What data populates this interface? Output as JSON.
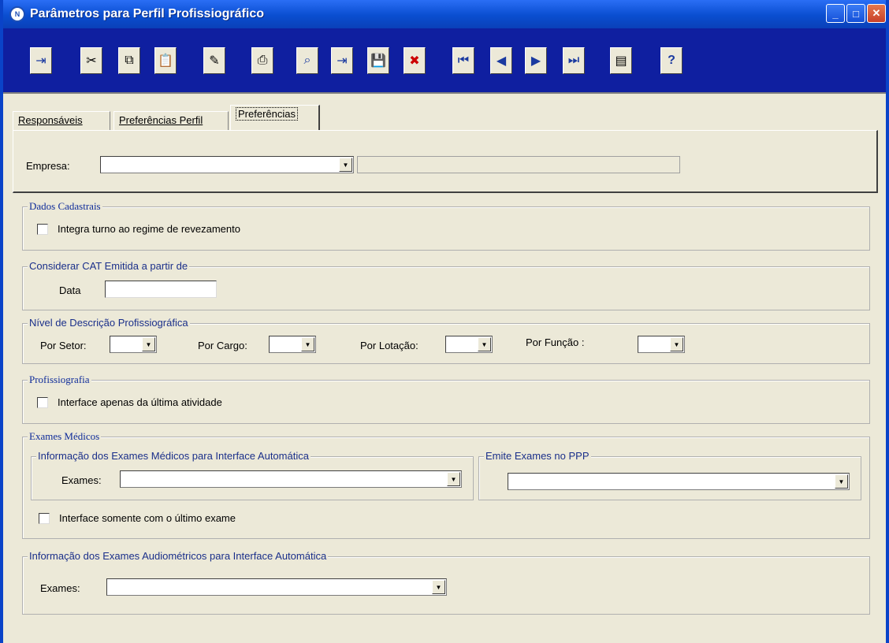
{
  "window": {
    "title": "Parâmetros para Perfil Profissiográfico",
    "app_icon_text": "N",
    "minimize_icon": "minimize-icon",
    "maximize_icon": "maximize-icon",
    "close_icon": "close-icon"
  },
  "toolbar": {
    "buttons": [
      {
        "name": "exit",
        "glyph": "⇥"
      },
      {
        "name": "cut",
        "glyph": "✂"
      },
      {
        "name": "copy",
        "glyph": "⧉"
      },
      {
        "name": "paste",
        "glyph": "📋"
      },
      {
        "name": "new",
        "glyph": "✎"
      },
      {
        "name": "print",
        "glyph": "⎙"
      },
      {
        "name": "search",
        "glyph": "⌕"
      },
      {
        "name": "import",
        "glyph": "⇥"
      },
      {
        "name": "save",
        "glyph": "💾"
      },
      {
        "name": "delete",
        "glyph": "✖"
      },
      {
        "name": "first",
        "glyph": "⏮"
      },
      {
        "name": "previous",
        "glyph": "◀"
      },
      {
        "name": "next",
        "glyph": "▶"
      },
      {
        "name": "last",
        "glyph": "⏭"
      },
      {
        "name": "list",
        "glyph": "▤"
      },
      {
        "name": "help",
        "glyph": "?"
      }
    ]
  },
  "tabs": [
    {
      "label": "Responsáveis",
      "active": false
    },
    {
      "label": "Preferências Perfil",
      "active": false
    },
    {
      "label": "Preferências",
      "active": true
    }
  ],
  "empresa": {
    "label": "Empresa:",
    "value": "",
    "description": ""
  },
  "dados_cadastrais": {
    "title": "Dados Cadastrais",
    "checkbox_label": "Integra turno ao regime de revezamento",
    "checked": false
  },
  "cat": {
    "title": "Considerar CAT Emitida a partir de",
    "data_label": "Data",
    "data_value": ""
  },
  "nivel": {
    "title": "Nível de Descrição Profissiográfica",
    "setor_label": "Por Setor:",
    "cargo_label": "Por Cargo:",
    "lotacao_label": "Por Lotação:",
    "funcao_label": "Por Função :"
  },
  "profissiografia": {
    "title": "Profissiografia",
    "checkbox_label": "Interface apenas da última atividade",
    "checked": false
  },
  "exames_medicos": {
    "title": "Exames Médicos",
    "info_title": "Informação dos Exames Médicos para Interface Automática",
    "exames_label": "Exames:",
    "emite_title": "Emite Exames no PPP",
    "checkbox_label": "Interface somente com o último exame",
    "checked": false
  },
  "audiometricos": {
    "title": "Informação dos Exames Audiométricos para Interface Automática",
    "exames_label": "Exames:"
  },
  "colors": {
    "titlebar": "#0a4ed0",
    "toolbar_bg": "#0f1fa0",
    "window_bg": "#ece9d8"
  }
}
